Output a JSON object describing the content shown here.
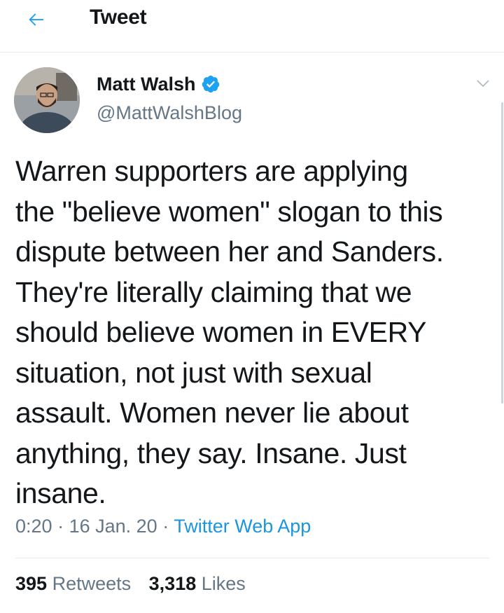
{
  "header": {
    "title": "Tweet",
    "back_icon": "arrow-left-icon",
    "accent_color": "#1da1f2"
  },
  "author": {
    "display_name": "Matt Walsh",
    "handle": "@MattWalshBlog",
    "verified": true,
    "verified_icon": "verified-badge-icon",
    "menu_icon": "chevron-down-icon"
  },
  "tweet": {
    "text": "Warren supporters are applying\nthe \"believe women\" slogan to this\ndispute between her and Sanders.\nThey're literally claiming that we\nshould believe women in EVERY\nsituation, not just with sexual\nassault. Women never lie about\nanything, they say. Insane. Just\ninsane."
  },
  "meta": {
    "time": "0:20",
    "separator": "·",
    "date": "16 Jan. 20",
    "source": "Twitter Web App"
  },
  "stats": {
    "retweets_count": "395",
    "retweets_label": "Retweets",
    "likes_count": "3,318",
    "likes_label": "Likes"
  },
  "colors": {
    "text_primary": "#14171a",
    "text_secondary": "#657786",
    "link": "#1b95e0",
    "divider": "#e6ecf0"
  }
}
